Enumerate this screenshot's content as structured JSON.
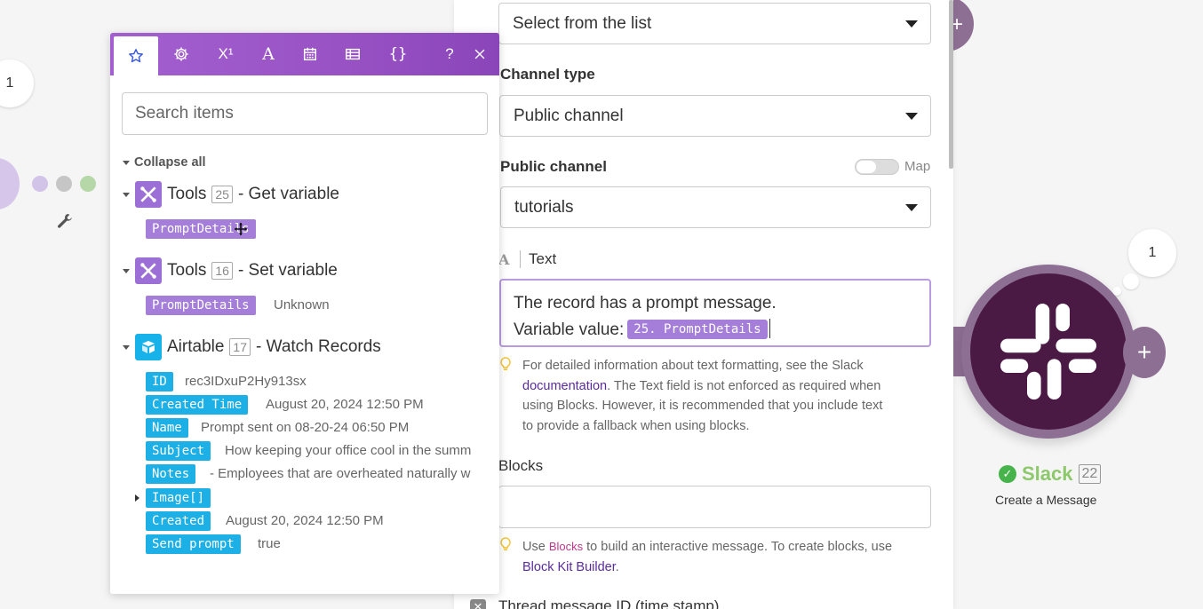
{
  "canvas": {
    "left_badge": "1",
    "right_badge": "1"
  },
  "form": {
    "top_select": "Select from the list",
    "channel_type_label": "Channel type",
    "channel_type_value": "Public channel",
    "public_channel_label": "Public channel",
    "map_label": "Map",
    "public_channel_value": "tutorials",
    "text_label": "Text",
    "text_line1": "The record has a prompt message.",
    "text_line2": "Variable value:",
    "text_pill": "25. PromptDetails",
    "hint1_a": "For detailed information about text formatting, see the Slack",
    "hint1_link": "documentation",
    "hint1_b": ". The Text field is not enforced as required when",
    "hint1_c": "using Blocks. However, it is recommended that you include text",
    "hint1_d": "to provide a fallback when using blocks.",
    "blocks_label": "Blocks",
    "hint2_a": "Use",
    "hint2_word": "Blocks",
    "hint2_b": "to build an interactive message. To create blocks, use",
    "hint2_link": "Block Kit Builder",
    "hint2_c": ".",
    "thread_label": "Thread message ID (time stamp)"
  },
  "slack_node": {
    "title": "Slack",
    "count": "22",
    "subtitle": "Create a Message"
  },
  "popup": {
    "tabs": [
      "favorite",
      "settings",
      "math",
      "text",
      "date",
      "table",
      "json"
    ],
    "help": "?",
    "search_placeholder": "Search items",
    "collapse_label": "Collapse all",
    "groups": [
      {
        "name": "Tools",
        "num": "25",
        "action": "- Get variable",
        "items": [
          {
            "key": "PromptDetails",
            "value": ""
          }
        ]
      },
      {
        "name": "Tools",
        "num": "16",
        "action": "- Set variable",
        "items": [
          {
            "key": "PromptDetails",
            "value": "Unknown"
          }
        ]
      },
      {
        "name": "Airtable",
        "num": "17",
        "action": "- Watch Records",
        "items": [
          {
            "key": "ID",
            "value": "rec3IDxuP2Hy913sx"
          },
          {
            "key": "Created Time",
            "value": "August 20, 2024 12:50 PM"
          },
          {
            "key": "Name",
            "value": "Prompt sent on 08-20-24 06:50 PM"
          },
          {
            "key": "Subject",
            "value": "How keeping your office cool in the summ"
          },
          {
            "key": "Notes",
            "value": "- Employees that are overheated naturally w"
          },
          {
            "key": "Image[]",
            "value": ""
          },
          {
            "key": "Created",
            "value": "August 20, 2024 12:50 PM"
          },
          {
            "key": "Send prompt",
            "value": "true"
          }
        ]
      }
    ]
  },
  "colors": {
    "popup_gradient": "#9852c4",
    "purple_pill": "#a47ed8",
    "blue_pill": "#1cb0e6",
    "slack_core": "#4a1a45",
    "slack_ring": "#8e6f94",
    "success": "#46b34b"
  }
}
